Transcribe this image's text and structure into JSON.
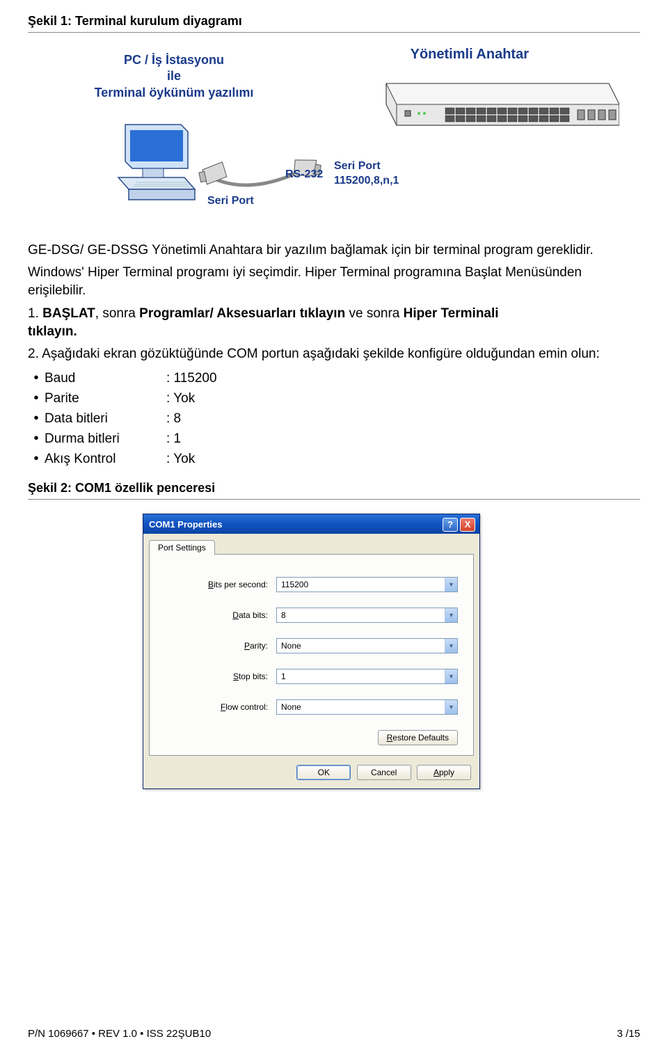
{
  "fig1_title": "Şekil 1: Terminal kurulum diyagramı",
  "diagram": {
    "pc_label_l1": "PC / İş İstasyonu",
    "pc_label_l2": "ile",
    "pc_label_l3": "Terminal öykünüm yazılımı",
    "switch_label": "Yönetimli Anahtar",
    "seri_port": "Seri Port",
    "rs232": "RS-232",
    "seri_port2_l1": "Seri Port",
    "seri_port2_l2": "115200,8,n,1"
  },
  "para1": "GE-DSG/ GE-DSSG Yönetimli Anahtara bir yazılım bağlamak için bir terminal program gereklidir.",
  "para2": "Windows' Hiper Terminal programı iyi seçimdir. Hiper Terminal programına Başlat Menüsünden erişilebilir.",
  "step1_pre": "1.   ",
  "step1_b1": "BAŞLAT",
  "step1_m1": ", sonra ",
  "step1_b2": "Programlar/ Aksesuarları tıklayın",
  "step1_m2": " ve sonra ",
  "step1_b3": "Hiper Terminali",
  "step1_end": "tıklayın.",
  "step2": "2.   Aşağıdaki ekran gözüktüğünde COM portun aşağıdaki şekilde konfigüre olduğundan emin olun:",
  "bullets": [
    {
      "label": "Baud",
      "val": ": 115200"
    },
    {
      "label": "Parite",
      "val": ": Yok"
    },
    {
      "label": "Data bitleri",
      "val": ": 8"
    },
    {
      "label": "Durma bitleri",
      "val": ": 1"
    },
    {
      "label": "Akış Kontrol",
      "val": ": Yok"
    }
  ],
  "fig2_title": "Şekil 2: COM1 özellik penceresi",
  "dialog": {
    "title": "COM1 Properties",
    "help": "?",
    "close": "X",
    "tab": "Port Settings",
    "fields": {
      "bps_u": "B",
      "bps_rest": "its per second:",
      "bps_val": "115200",
      "db_u": "D",
      "db_rest": "ata bits:",
      "db_val": "8",
      "par_u": "P",
      "par_rest": "arity:",
      "par_val": "None",
      "sb_u": "S",
      "sb_rest": "top bits:",
      "sb_val": "1",
      "fc_u": "F",
      "fc_rest": "low control:",
      "fc_val": "None"
    },
    "restore_u": "R",
    "restore_rest": "estore Defaults",
    "ok": "OK",
    "cancel": "Cancel",
    "apply_u": "A",
    "apply_rest": "pply"
  },
  "footer": {
    "left": "P/N 1069667 • REV 1.0 • ISS 22ŞUB10",
    "right": "3 /15"
  }
}
